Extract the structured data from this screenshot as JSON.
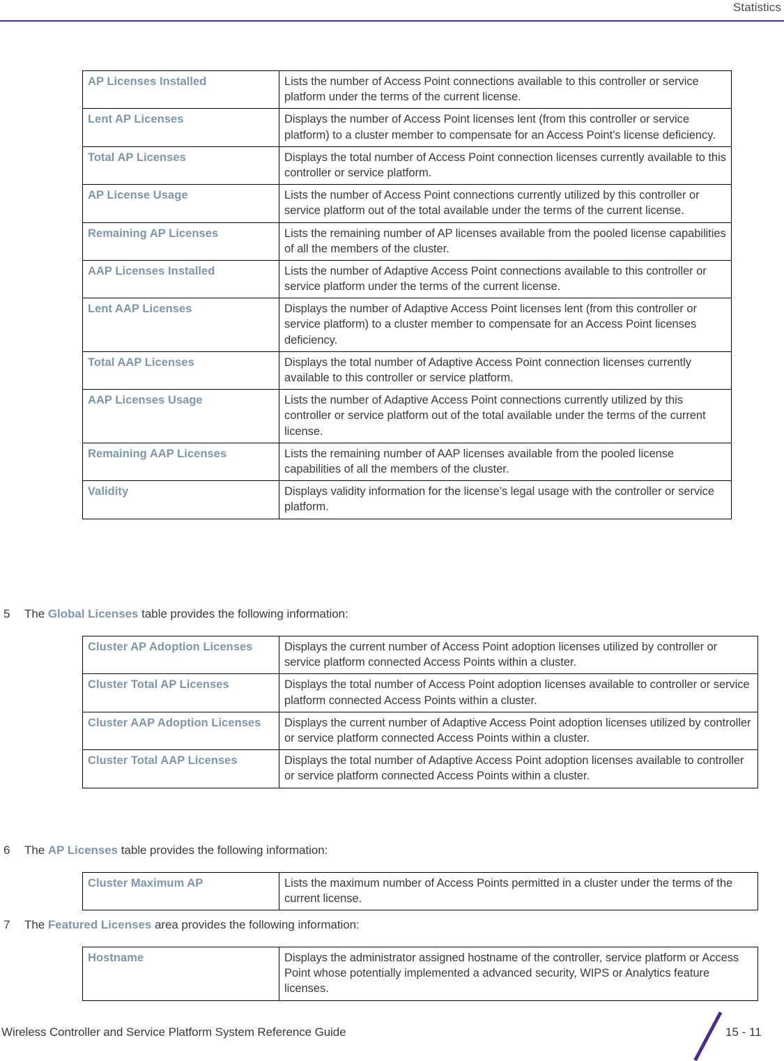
{
  "header": {
    "title": "Statistics",
    "rule_color": "#4b2d8f"
  },
  "colors": {
    "label_accent": "#7e96ad",
    "body_text": "#3a3a3a",
    "brand_purple": "#4b2d8f",
    "table_border": "#000000"
  },
  "tables": {
    "licenses": {
      "rows": [
        {
          "label": "AP Licenses Installed",
          "description": "Lists the number of Access Point connections available to this controller or service platform under the terms of the current license."
        },
        {
          "label": "Lent AP Licenses",
          "description": "Displays the number of Access Point licenses lent (from this controller or service platform) to a cluster member to compensate for an Access Point’s license deficiency."
        },
        {
          "label": "Total AP Licenses",
          "description": "Displays the total number of Access Point connection licenses currently available to this controller or service platform."
        },
        {
          "label": "AP License Usage",
          "description": "Lists the number of Access Point connections currently utilized by this controller or service platform out of the total available under the terms of the current license."
        },
        {
          "label": "Remaining AP Licenses",
          "description": "Lists the remaining number of AP licenses available from the pooled license capabilities of all the members of the cluster."
        },
        {
          "label": "AAP Licenses Installed",
          "description": "Lists the number of Adaptive Access Point connections available to this controller or service platform under the terms of the current license."
        },
        {
          "label": "Lent AAP Licenses",
          "description": "Displays the number of Adaptive Access Point licenses lent (from this controller or service platform) to a cluster member to compensate for an Access Point licenses deficiency."
        },
        {
          "label": "Total AAP Licenses",
          "description": "Displays the total number of Adaptive Access Point connection licenses currently available to this controller or service platform."
        },
        {
          "label": "AAP Licenses Usage",
          "description": "Lists the number of Adaptive Access Point connections currently utilized by this controller or service platform out of the total available under the terms of the current license."
        },
        {
          "label": "Remaining AAP Licenses",
          "description": "Lists the remaining number of AAP licenses available from the pooled license capabilities of all the members of the cluster."
        },
        {
          "label": "Validity",
          "description": "Displays validity information for the license’s legal usage with the controller or service platform."
        }
      ]
    },
    "global": {
      "rows": [
        {
          "label": "Cluster AP Adoption Licenses",
          "description": "Displays the current number of Access Point adoption licenses utilized by controller or service platform connected Access Points within a cluster."
        },
        {
          "label": "Cluster Total AP Licenses",
          "description": "Displays the total number of Access Point adoption licenses available to controller or service platform connected Access Points within a cluster."
        },
        {
          "label": "Cluster AAP Adoption Licenses",
          "description": "Displays the current number of Adaptive Access Point adoption licenses utilized by controller or service platform connected Access Points within a cluster."
        },
        {
          "label": "Cluster Total AAP Licenses",
          "description": "Displays the total number of Adaptive Access Point adoption licenses available to controller or service platform connected Access Points within a cluster."
        }
      ]
    },
    "ap": {
      "rows": [
        {
          "label": "Cluster Maximum AP",
          "description": "Lists the maximum number of Access Points permitted in a cluster under the terms of the current license."
        }
      ]
    },
    "featured": {
      "rows": [
        {
          "label": "Hostname",
          "description": "Displays the administrator assigned hostname of the controller, service platform or Access Point whose potentially implemented a advanced security, WIPS or Analytics feature licenses."
        }
      ]
    }
  },
  "steps": [
    {
      "number": "5",
      "prefix": "The ",
      "emphasis": "Global Licenses",
      "suffix": " table provides the following information:"
    },
    {
      "number": "6",
      "prefix": "The ",
      "emphasis": "AP Licenses",
      "suffix": " table provides the following information:"
    },
    {
      "number": "7",
      "prefix": "The ",
      "emphasis": "Featured Licenses",
      "suffix": " area provides the following information:"
    }
  ],
  "footer": {
    "guide_title": "Wireless Controller and Service Platform System Reference Guide",
    "page_number": "15 - 11"
  }
}
